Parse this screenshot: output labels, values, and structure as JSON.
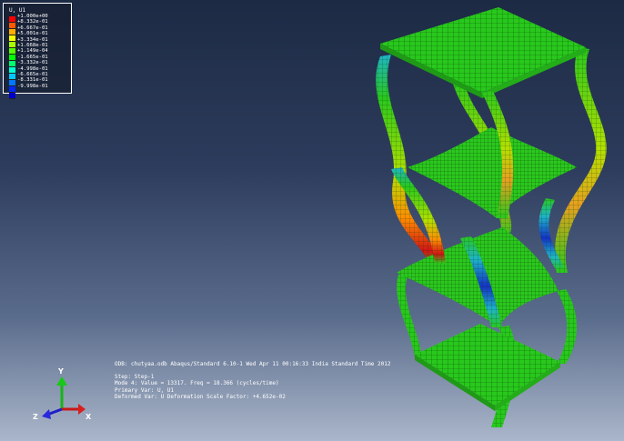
{
  "legend": {
    "title": "U, U1",
    "labels": [
      "+1.000e+00",
      "+8.332e-01",
      "+6.667e-01",
      "+5.001e-01",
      "+3.334e-01",
      "+1.668e-01",
      "+1.149e-04",
      "-1.665e-01",
      "-3.332e-01",
      "-4.998e-01",
      "-6.665e-01",
      "-8.331e-01",
      "-9.998e-01"
    ],
    "colors": [
      "#ff0000",
      "#ff5a00",
      "#ffae00",
      "#f4ff00",
      "#a9ff00",
      "#55ff00",
      "#00ff00",
      "#00ff6e",
      "#00ffd2",
      "#00c8ff",
      "#0078ff",
      "#0028ff",
      "#0000c8"
    ]
  },
  "info": {
    "odb_line": "ODB: chutyaa.odb    Abaqus/Standard 6.10-1    Wed Apr 11 00:16:33 India Standard Time 2012",
    "step_line": "Step: Step-1",
    "mode_line": "Mode        4: Value =   13317.     Freq =   18.366    (cycles/time)",
    "primary_line": "Primary Var: U, U1",
    "deformed_line": "Deformed Var: U   Deformation Scale Factor: +4.652e-02"
  },
  "triad": {
    "y": "Y",
    "z": "Z",
    "x": "X"
  },
  "model": {
    "mesh_color": "#28c81c",
    "mesh_line_color": "#0d5a0a",
    "accent_colors": {
      "red": "#d21414",
      "orange": "#e8a020",
      "blue": "#1432c8",
      "cyan": "#1eb4c8"
    }
  }
}
